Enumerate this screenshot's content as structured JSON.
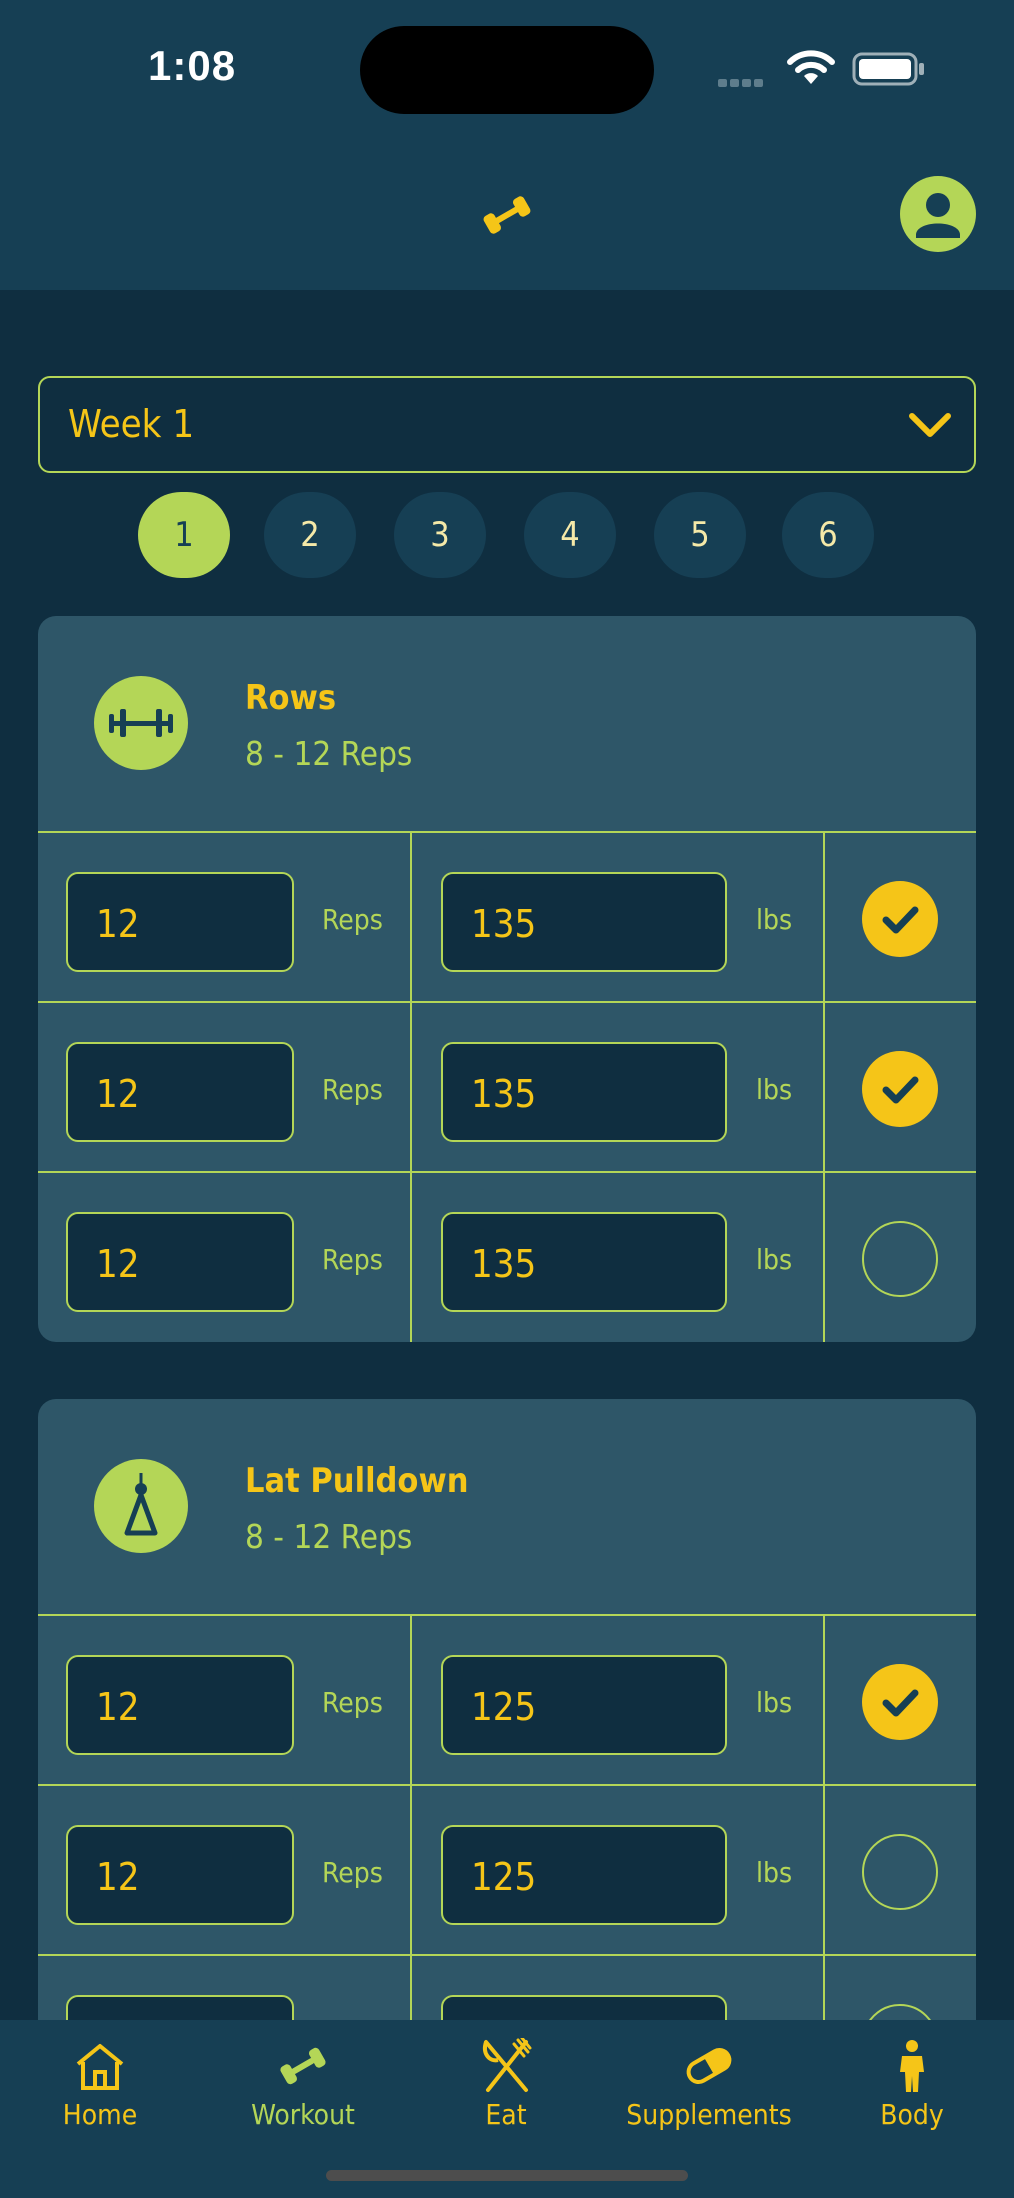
{
  "status": {
    "time": "1:08"
  },
  "week": {
    "label": "Week 1"
  },
  "days": [
    "1",
    "2",
    "3",
    "4",
    "5",
    "6"
  ],
  "active_day": "1",
  "colors": {
    "accent_yellow": "#f5c518",
    "accent_green": "#b4d657",
    "header_bg": "#163f54",
    "page_bg": "#0f2e40",
    "card_bg": "#2e5668"
  },
  "exercises": [
    {
      "name": "Rows",
      "reps_range": "8 - 12 Reps",
      "icon": "barbell-icon",
      "sets": [
        {
          "reps": "12",
          "reps_unit": "Reps",
          "weight": "135",
          "weight_unit": "lbs",
          "done": true
        },
        {
          "reps": "12",
          "reps_unit": "Reps",
          "weight": "135",
          "weight_unit": "lbs",
          "done": true
        },
        {
          "reps": "12",
          "reps_unit": "Reps",
          "weight": "135",
          "weight_unit": "lbs",
          "done": false
        }
      ]
    },
    {
      "name": "Lat Pulldown",
      "reps_range": "8 - 12 Reps",
      "icon": "cable-handle-icon",
      "sets": [
        {
          "reps": "12",
          "reps_unit": "Reps",
          "weight": "125",
          "weight_unit": "lbs",
          "done": true
        },
        {
          "reps": "12",
          "reps_unit": "Reps",
          "weight": "125",
          "weight_unit": "lbs",
          "done": false
        },
        {
          "reps": "",
          "reps_unit": "",
          "weight": "",
          "weight_unit": "",
          "done": false
        }
      ]
    }
  ],
  "tabs": [
    {
      "label": "Home",
      "icon": "home-icon",
      "active": true
    },
    {
      "label": "Workout",
      "icon": "dumbbell-icon",
      "active": false
    },
    {
      "label": "Eat",
      "icon": "fork-knife-icon",
      "active": true
    },
    {
      "label": "Supplements",
      "icon": "pill-icon",
      "active": true
    },
    {
      "label": "Body",
      "icon": "person-icon",
      "active": true
    }
  ]
}
